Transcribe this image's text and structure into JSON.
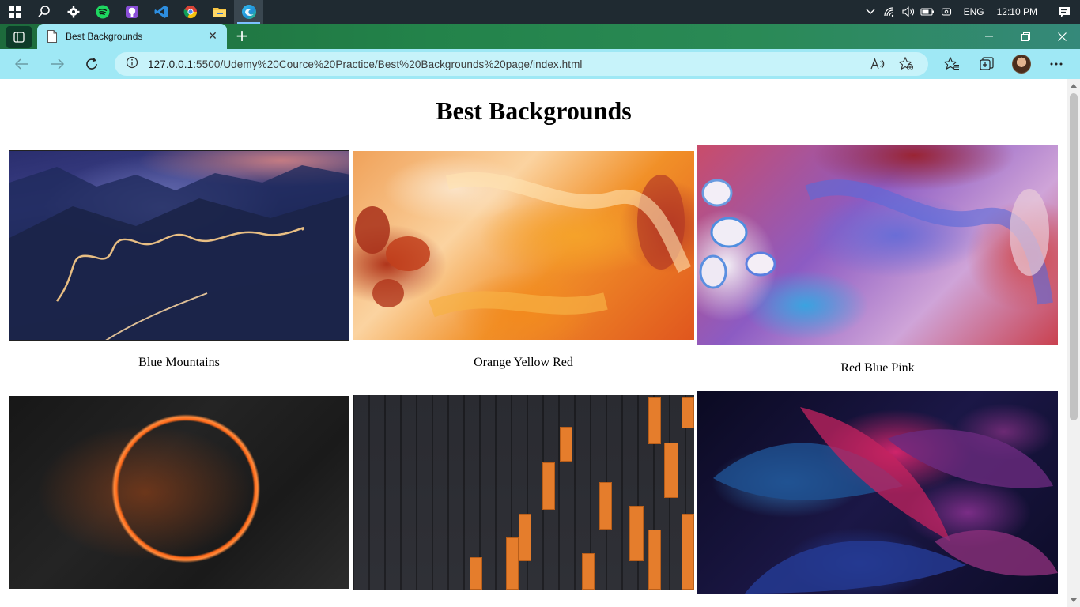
{
  "taskbar": {
    "icons": [
      "windows-start-icon",
      "search-icon",
      "settings-icon",
      "spotify-icon",
      "github-icon",
      "vscode-icon",
      "chrome-icon",
      "file-explorer-icon",
      "edge-icon"
    ],
    "language": "ENG",
    "time": "12:10 PM"
  },
  "browser": {
    "tab_title": "Best Backgrounds",
    "url_host": "127.0.0.1",
    "url_rest": ":5500/Udemy%20Cource%20Practice/Best%20Backgrounds%20page/index.html"
  },
  "page": {
    "title": "Best Backgrounds",
    "cards": [
      {
        "caption": "Blue Mountains"
      },
      {
        "caption": "Orange Yellow Red"
      },
      {
        "caption": "Red Blue Pink"
      },
      {
        "caption": ""
      },
      {
        "caption": ""
      },
      {
        "caption": ""
      }
    ]
  },
  "colors": {
    "taskbar": "#1f2a31",
    "tab_bar_green": "#23834a",
    "toolbar_cyan": "#9fe8f5",
    "address_bar": "#c7f3fa"
  }
}
